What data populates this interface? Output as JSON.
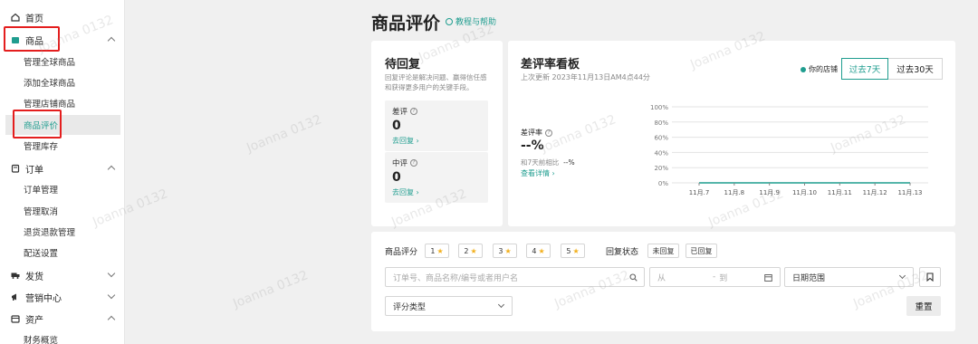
{
  "sidebar": {
    "home": "首页",
    "product": "商品",
    "product_items": [
      "管理全球商品",
      "添加全球商品",
      "管理店铺商品",
      "商品评价",
      "管理库存"
    ],
    "orders": "订单",
    "order_items": [
      "订单管理",
      "管理取消",
      "退货退款管理",
      "配送设置"
    ],
    "shipping": "发货",
    "marketing": "营销中心",
    "finance": "资产",
    "finance_items": [
      "财务概览"
    ]
  },
  "watermark": "Joanna 0132",
  "header": {
    "title": "商品评价",
    "help": "教程与帮助"
  },
  "pending": {
    "title": "待回复",
    "desc_line1": "回复评论是解决问题、赢得信任感",
    "desc_line2": "和获得更多用户的关键手段。",
    "negative": {
      "label": "差评",
      "value": "0",
      "link": "去回复 ›"
    },
    "neutral": {
      "label": "中评",
      "value": "0",
      "link": "去回复 ›"
    }
  },
  "board": {
    "title": "差评率看板",
    "updated": "上次更新 2023年11月13日AM4点44分",
    "legend": "你的店铺",
    "tabs": [
      "过去7天",
      "过去30天"
    ],
    "rate_label": "差评率",
    "rate_value": "--%",
    "compare_label": "和7天前相比",
    "compare_value": "--%",
    "detail_link": "查看详情 ›"
  },
  "filters": {
    "rating_label": "商品评分",
    "ratings": [
      "1",
      "2",
      "3",
      "4",
      "5"
    ],
    "reply_label": "回复状态",
    "reply_options": [
      "未回复",
      "已回复"
    ],
    "search_placeholder": "订单号、商品名称/编号或者用户名",
    "date_from": "从",
    "date_to": "到",
    "date_range": "日期范围",
    "rating_type": "评分类型",
    "reset": "重置"
  },
  "chart_data": {
    "type": "line",
    "categories": [
      "11月.7",
      "11月.8",
      "11月.9",
      "11月.10",
      "11月.11",
      "11月.12",
      "11月.13"
    ],
    "series": [
      {
        "name": "你的店铺",
        "values": [
          0,
          0,
          0,
          0,
          0,
          0,
          0
        ]
      }
    ],
    "yticks": [
      "100%",
      "80%",
      "60%",
      "40%",
      "20%",
      "0%"
    ],
    "ylim": [
      0,
      100
    ],
    "grid": true,
    "color": "#1f9d8f"
  },
  "colors": {
    "accent": "#1f9d8f",
    "highlight": "#e41e1e",
    "star": "#f2b01e"
  }
}
